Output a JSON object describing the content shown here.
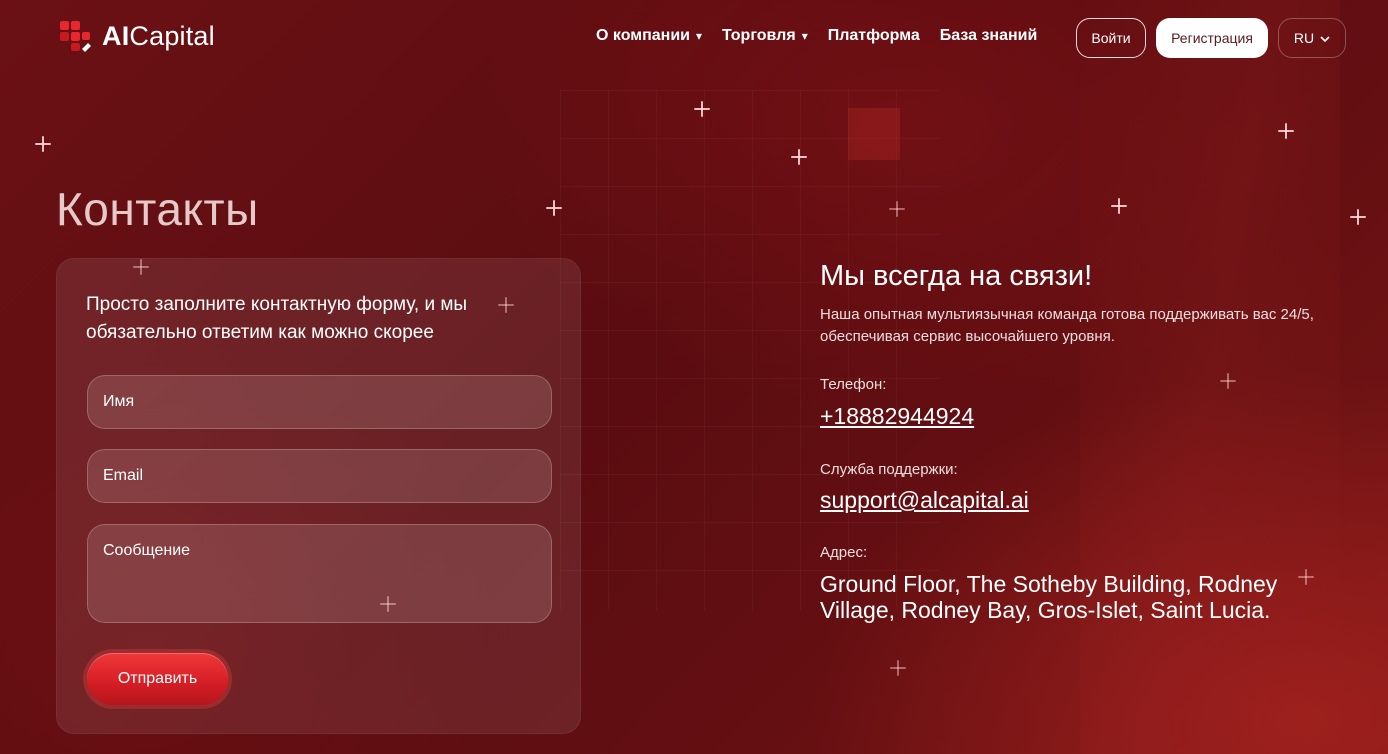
{
  "header": {
    "logo_prefix": "AI",
    "logo_suffix": "Capital",
    "nav": [
      {
        "label": "О компании",
        "caret": "▾"
      },
      {
        "label": "Торговля",
        "caret": "▾"
      },
      {
        "label": "Платформа"
      },
      {
        "label": "База знаний"
      }
    ],
    "login_label": "Войти",
    "register_label": "Регистрация",
    "language": "RU"
  },
  "page_title": "Контакты",
  "form": {
    "intro": "Просто заполните контактную форму, и мы обязательно ответим как можно скорее",
    "name_placeholder": "Имя",
    "email_placeholder": "Email",
    "message_placeholder": "Сообщение",
    "submit_label": "Отправить"
  },
  "contact": {
    "heading": "Мы всегда на связи!",
    "description": "Наша опытная мультиязычная команда готова поддерживать вас 24/5, обеспечивая сервис высочайшего уровня.",
    "phone_label": "Телефон:",
    "phone": "+18882944924",
    "support_label": "Служба поддержки:",
    "support_email": "support@alcapital.ai",
    "address_label": "Адрес:",
    "address": "Ground Floor, The Sotheby Building, Rodney Village, Rodney Bay, Gros-Islet, Saint Lucia."
  },
  "colors": {
    "background": "#5e0d10",
    "accent": "#e02a2e",
    "logo_red": "#e8262d"
  }
}
